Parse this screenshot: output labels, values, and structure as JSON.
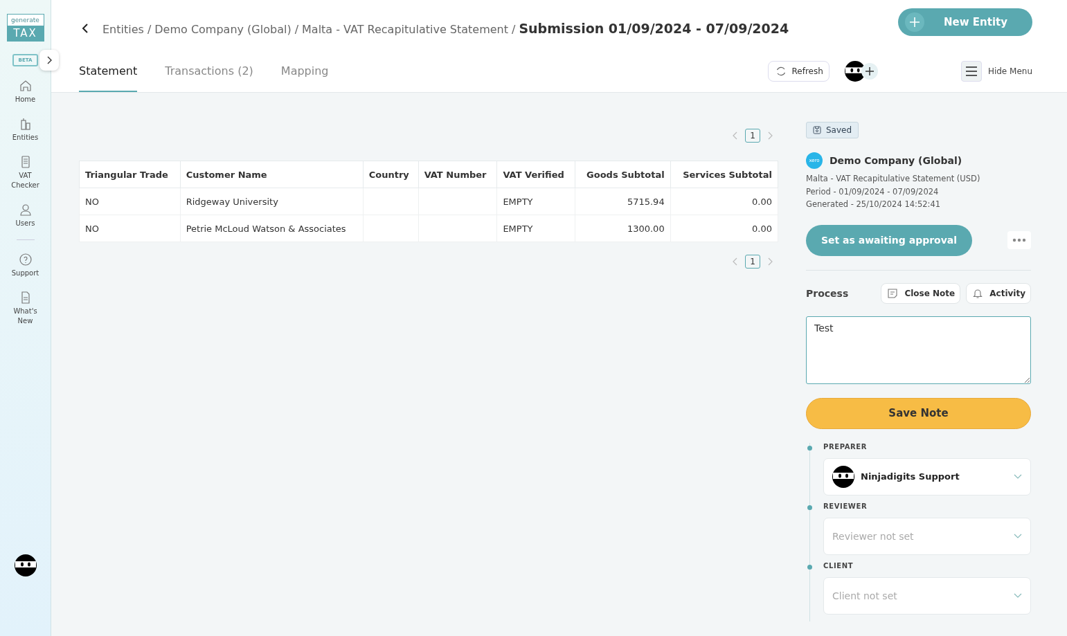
{
  "sidebar": {
    "logo": {
      "top": "generate",
      "bottom": "TAX"
    },
    "badge": "BETA",
    "items": [
      {
        "label": "Home"
      },
      {
        "label": "Entities"
      },
      {
        "label": "VAT Checker"
      },
      {
        "label": "Users"
      }
    ],
    "bottom_items": [
      {
        "label": "Support"
      },
      {
        "label": "What's New"
      }
    ]
  },
  "header": {
    "breadcrumb": [
      {
        "label": "Entities",
        "separator": "/"
      },
      {
        "label": "Demo Company (Global)",
        "separator": "/"
      },
      {
        "label": "Malta - VAT Recapitulative Statement",
        "separator": "/"
      }
    ],
    "title": "Submission 01/09/2024 - 07/09/2024",
    "new_button": "New Entity",
    "refresh_button": "Refresh",
    "menu_button": "Hide Menu",
    "tabs": [
      {
        "label": "Statement",
        "selected": true
      },
      {
        "label": "Transactions (2)",
        "selected": false
      },
      {
        "label": "Mapping",
        "selected": false
      }
    ]
  },
  "pagination_top": [
    {
      "label": "1",
      "selected": true
    }
  ],
  "table": {
    "columns": [
      {
        "label": "Triangular Trade",
        "kind": "text"
      },
      {
        "label": "Customer Name",
        "kind": "text"
      },
      {
        "label": "Country",
        "kind": "text"
      },
      {
        "label": "VAT Number",
        "kind": "text"
      },
      {
        "label": "VAT Verified",
        "kind": "text"
      },
      {
        "label": "Goods Subtotal",
        "kind": "amount"
      },
      {
        "label": "Services Subtotal",
        "kind": "amount"
      }
    ],
    "rows": [
      [
        "NO",
        "Ridgeway University",
        "",
        "",
        "EMPTY",
        "5715.94",
        "0.00"
      ],
      [
        "NO",
        "Petrie McLoud Watson & Associates",
        "",
        "",
        "EMPTY",
        "1300.00",
        "0.00"
      ]
    ]
  },
  "pagination_bottom": [
    {
      "label": "1",
      "selected": true
    }
  ],
  "panel": {
    "status": "Saved",
    "company": "Demo Company (Global)",
    "source_badge": "xero",
    "details": [
      "Malta - VAT Recapitulative Statement (USD)",
      "Period - 01/09/2024 - 07/09/2024",
      "Generated - 25/10/2024 14:52:41"
    ],
    "action_button": "Set as awaiting approval",
    "process_label": "Process",
    "close_note_button": "Close Note",
    "activity_button": "Activity",
    "note": "Test",
    "save_button": "Save Note",
    "roles": [
      {
        "label": "PREPARER",
        "kind": "assigned",
        "value": "Ninjadigits Support"
      },
      {
        "label": "REVIEWER",
        "kind": "empty",
        "placeholder": "Reviewer not set"
      },
      {
        "label": "CLIENT",
        "kind": "empty",
        "placeholder": "Client not set"
      }
    ]
  }
}
